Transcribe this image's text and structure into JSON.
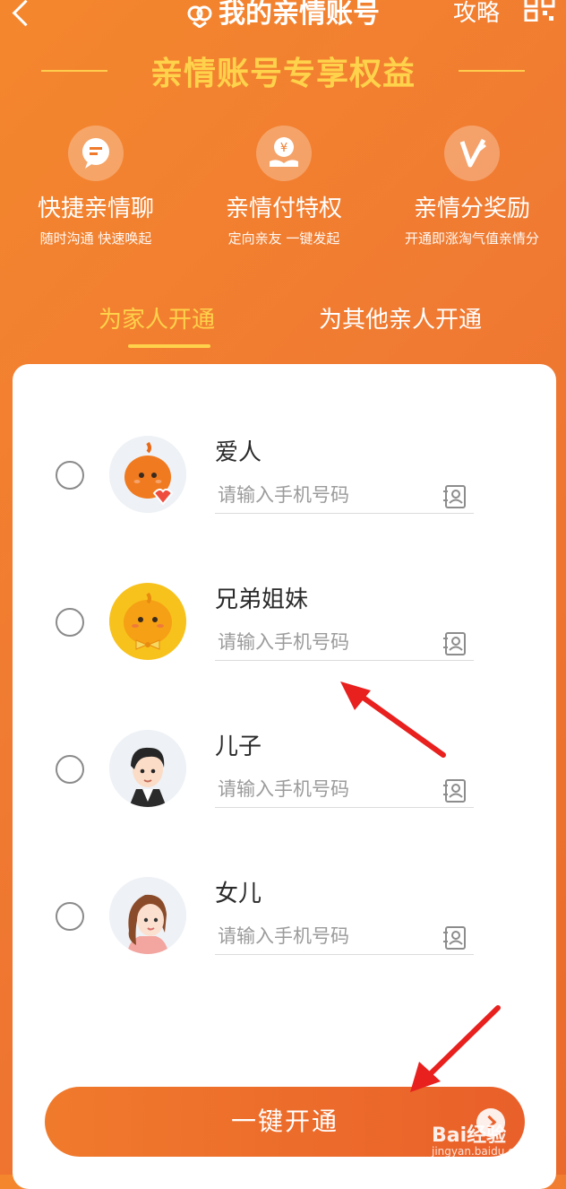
{
  "header": {
    "title": "我的亲情账号",
    "strategy": "攻略",
    "back_icon": "back-chevron-icon",
    "qr_icon": "qr-code-icon"
  },
  "banner": {
    "title": "亲情账号专享权益"
  },
  "benefits": [
    {
      "title": "快捷亲情聊",
      "subtitle": "随时沟通 快速唤起",
      "icon": "chat-bubble-icon"
    },
    {
      "title": "亲情付特权",
      "subtitle": "定向亲友 一键发起",
      "icon": "yuan-hand-icon"
    },
    {
      "title": "亲情分奖励",
      "subtitle": "开通即涨淘气值亲情分",
      "icon": "v-badge-icon"
    }
  ],
  "tabs": [
    {
      "label": "为家人开通",
      "active": true
    },
    {
      "label": "为其他亲人开通",
      "active": false
    }
  ],
  "family": [
    {
      "relation": "爱人",
      "placeholder": "请输入手机号码"
    },
    {
      "relation": "兄弟姐妹",
      "placeholder": "请输入手机号码"
    },
    {
      "relation": "儿子",
      "placeholder": "请输入手机号码"
    },
    {
      "relation": "女儿",
      "placeholder": "请输入手机号码"
    }
  ],
  "cta": {
    "label": "一键开通"
  },
  "watermark": {
    "brand": "Bai经验",
    "url": "jingyan.baidu.com"
  },
  "colors": {
    "accent": "#f07a2c",
    "highlight": "#ffd24b",
    "annotation_arrow": "#e8201e"
  }
}
